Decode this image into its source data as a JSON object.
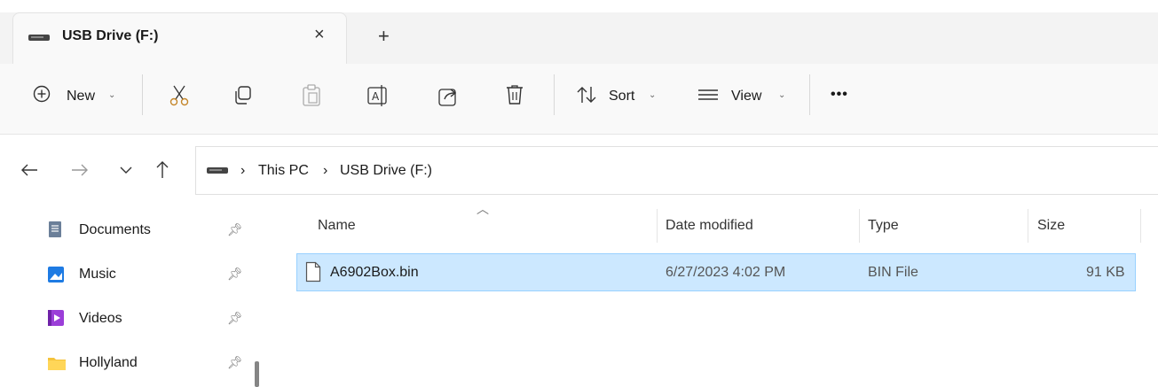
{
  "tab": {
    "title": "USB Drive (F:)",
    "close_icon": "×",
    "new_tab_icon": "+"
  },
  "toolbar": {
    "new_label": "New",
    "sort_label": "Sort",
    "view_label": "View",
    "more_label": "•••",
    "chevron": "⌄"
  },
  "breadcrumb": {
    "separator": "›",
    "items": [
      "This PC",
      "USB Drive (F:)"
    ]
  },
  "sidebar": {
    "items": [
      {
        "label": "Documents",
        "icon": "documents-icon",
        "color": "#6b7f99"
      },
      {
        "label": "Music",
        "icon": "music-icon",
        "color": "#1e7be3"
      },
      {
        "label": "Videos",
        "icon": "videos-icon",
        "color": "#9b3ed8"
      },
      {
        "label": "Hollyland",
        "icon": "folder-icon",
        "color": "#f5c33b"
      }
    ]
  },
  "columns": {
    "name": "Name",
    "date": "Date modified",
    "type": "Type",
    "size": "Size"
  },
  "files": [
    {
      "name": "A6902Box.bin",
      "date": "6/27/2023 4:02 PM",
      "type": "BIN File",
      "size": "91 KB",
      "selected": true
    }
  ],
  "colors": {
    "selection": "#cce8ff",
    "selection_border": "#99d1ff"
  }
}
